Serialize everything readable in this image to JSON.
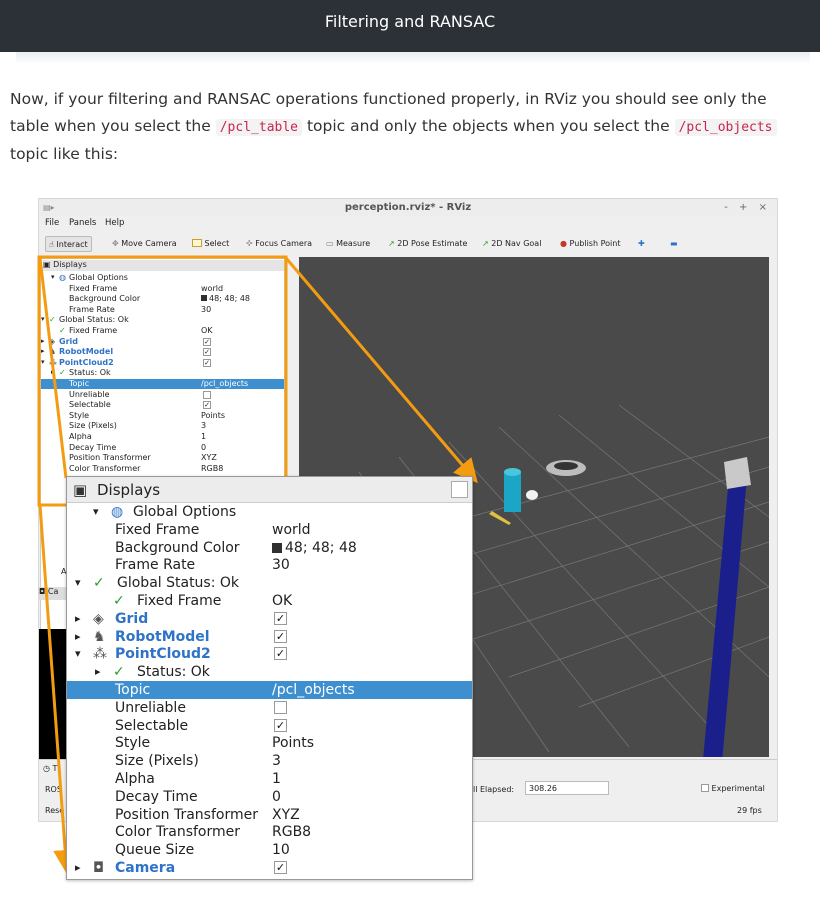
{
  "header": {
    "title": "Filtering and RANSAC"
  },
  "paragraph": {
    "part1": "Now, if your filtering and RANSAC operations functioned properly, in RViz you should see only the table when you select the ",
    "code1": "/pcl_table",
    "part2": " topic and only the objects when you select the ",
    "code2": "/pcl_objects",
    "part3": " topic like this:"
  },
  "rviz": {
    "window_title": "perception.rviz* - RViz",
    "window_controls": "- + ×",
    "menu": [
      "File",
      "Panels",
      "Help"
    ],
    "toolbar": [
      "Interact",
      "Move Camera",
      "Select",
      "Focus Camera",
      "Measure",
      "2D Pose Estimate",
      "2D Nav Goal",
      "Publish Point"
    ],
    "small_panel": {
      "title": "Displays",
      "rows": [
        {
          "k": "Global Options",
          "v": ""
        },
        {
          "k": "Fixed Frame",
          "v": "world"
        },
        {
          "k": "Background Color",
          "v": "48; 48; 48"
        },
        {
          "k": "Frame Rate",
          "v": "30"
        },
        {
          "k": "Global Status: Ok",
          "v": ""
        },
        {
          "k": "Fixed Frame",
          "v": "OK"
        },
        {
          "k": "Grid",
          "v": ""
        },
        {
          "k": "RobotModel",
          "v": ""
        },
        {
          "k": "PointCloud2",
          "v": ""
        },
        {
          "k": "Status: Ok",
          "v": ""
        },
        {
          "k": "Topic",
          "v": "/pcl_objects"
        },
        {
          "k": "Unreliable",
          "v": ""
        },
        {
          "k": "Selectable",
          "v": ""
        },
        {
          "k": "Style",
          "v": "Points"
        },
        {
          "k": "Size (Pixels)",
          "v": "3"
        },
        {
          "k": "Alpha",
          "v": "1"
        },
        {
          "k": "Decay Time",
          "v": "0"
        },
        {
          "k": "Position Transformer",
          "v": "XYZ"
        },
        {
          "k": "Color Transformer",
          "v": "RGB8"
        }
      ]
    },
    "timebar": {
      "elapsed_label": "ll Elapsed:",
      "elapsed_value": "308.26",
      "experimental_label": "Experimental",
      "fps": "29 fps",
      "ros_label": "ROS",
      "reset_label": "Rese",
      "a_label": "A",
      "ca_label": "Ca"
    }
  },
  "inset": {
    "title": "Displays",
    "rows": [
      {
        "k": "Global Options",
        "v": ""
      },
      {
        "k": "Fixed Frame",
        "v": "world"
      },
      {
        "k": "Background Color",
        "v": "48; 48; 48"
      },
      {
        "k": "Frame Rate",
        "v": "30"
      },
      {
        "k": "Global Status: Ok",
        "v": ""
      },
      {
        "k": "Fixed Frame",
        "v": "OK"
      },
      {
        "k": "Grid",
        "v": ""
      },
      {
        "k": "RobotModel",
        "v": ""
      },
      {
        "k": "PointCloud2",
        "v": ""
      },
      {
        "k": "Status: Ok",
        "v": ""
      },
      {
        "k": "Topic",
        "v": "/pcl_objects"
      },
      {
        "k": "Unreliable",
        "v": ""
      },
      {
        "k": "Selectable",
        "v": ""
      },
      {
        "k": "Style",
        "v": "Points"
      },
      {
        "k": "Size (Pixels)",
        "v": "3"
      },
      {
        "k": "Alpha",
        "v": "1"
      },
      {
        "k": "Decay Time",
        "v": "0"
      },
      {
        "k": "Position Transformer",
        "v": "XYZ"
      },
      {
        "k": "Color Transformer",
        "v": "RGB8"
      },
      {
        "k": "Queue Size",
        "v": "10"
      },
      {
        "k": "Camera",
        "v": ""
      }
    ]
  },
  "colors": {
    "header_bg": "#2b3137",
    "highlight": "#f39c12",
    "selection": "#3d8fcf",
    "viewport_bg": "#4a4a4a",
    "pole": "#1a1f8c"
  }
}
